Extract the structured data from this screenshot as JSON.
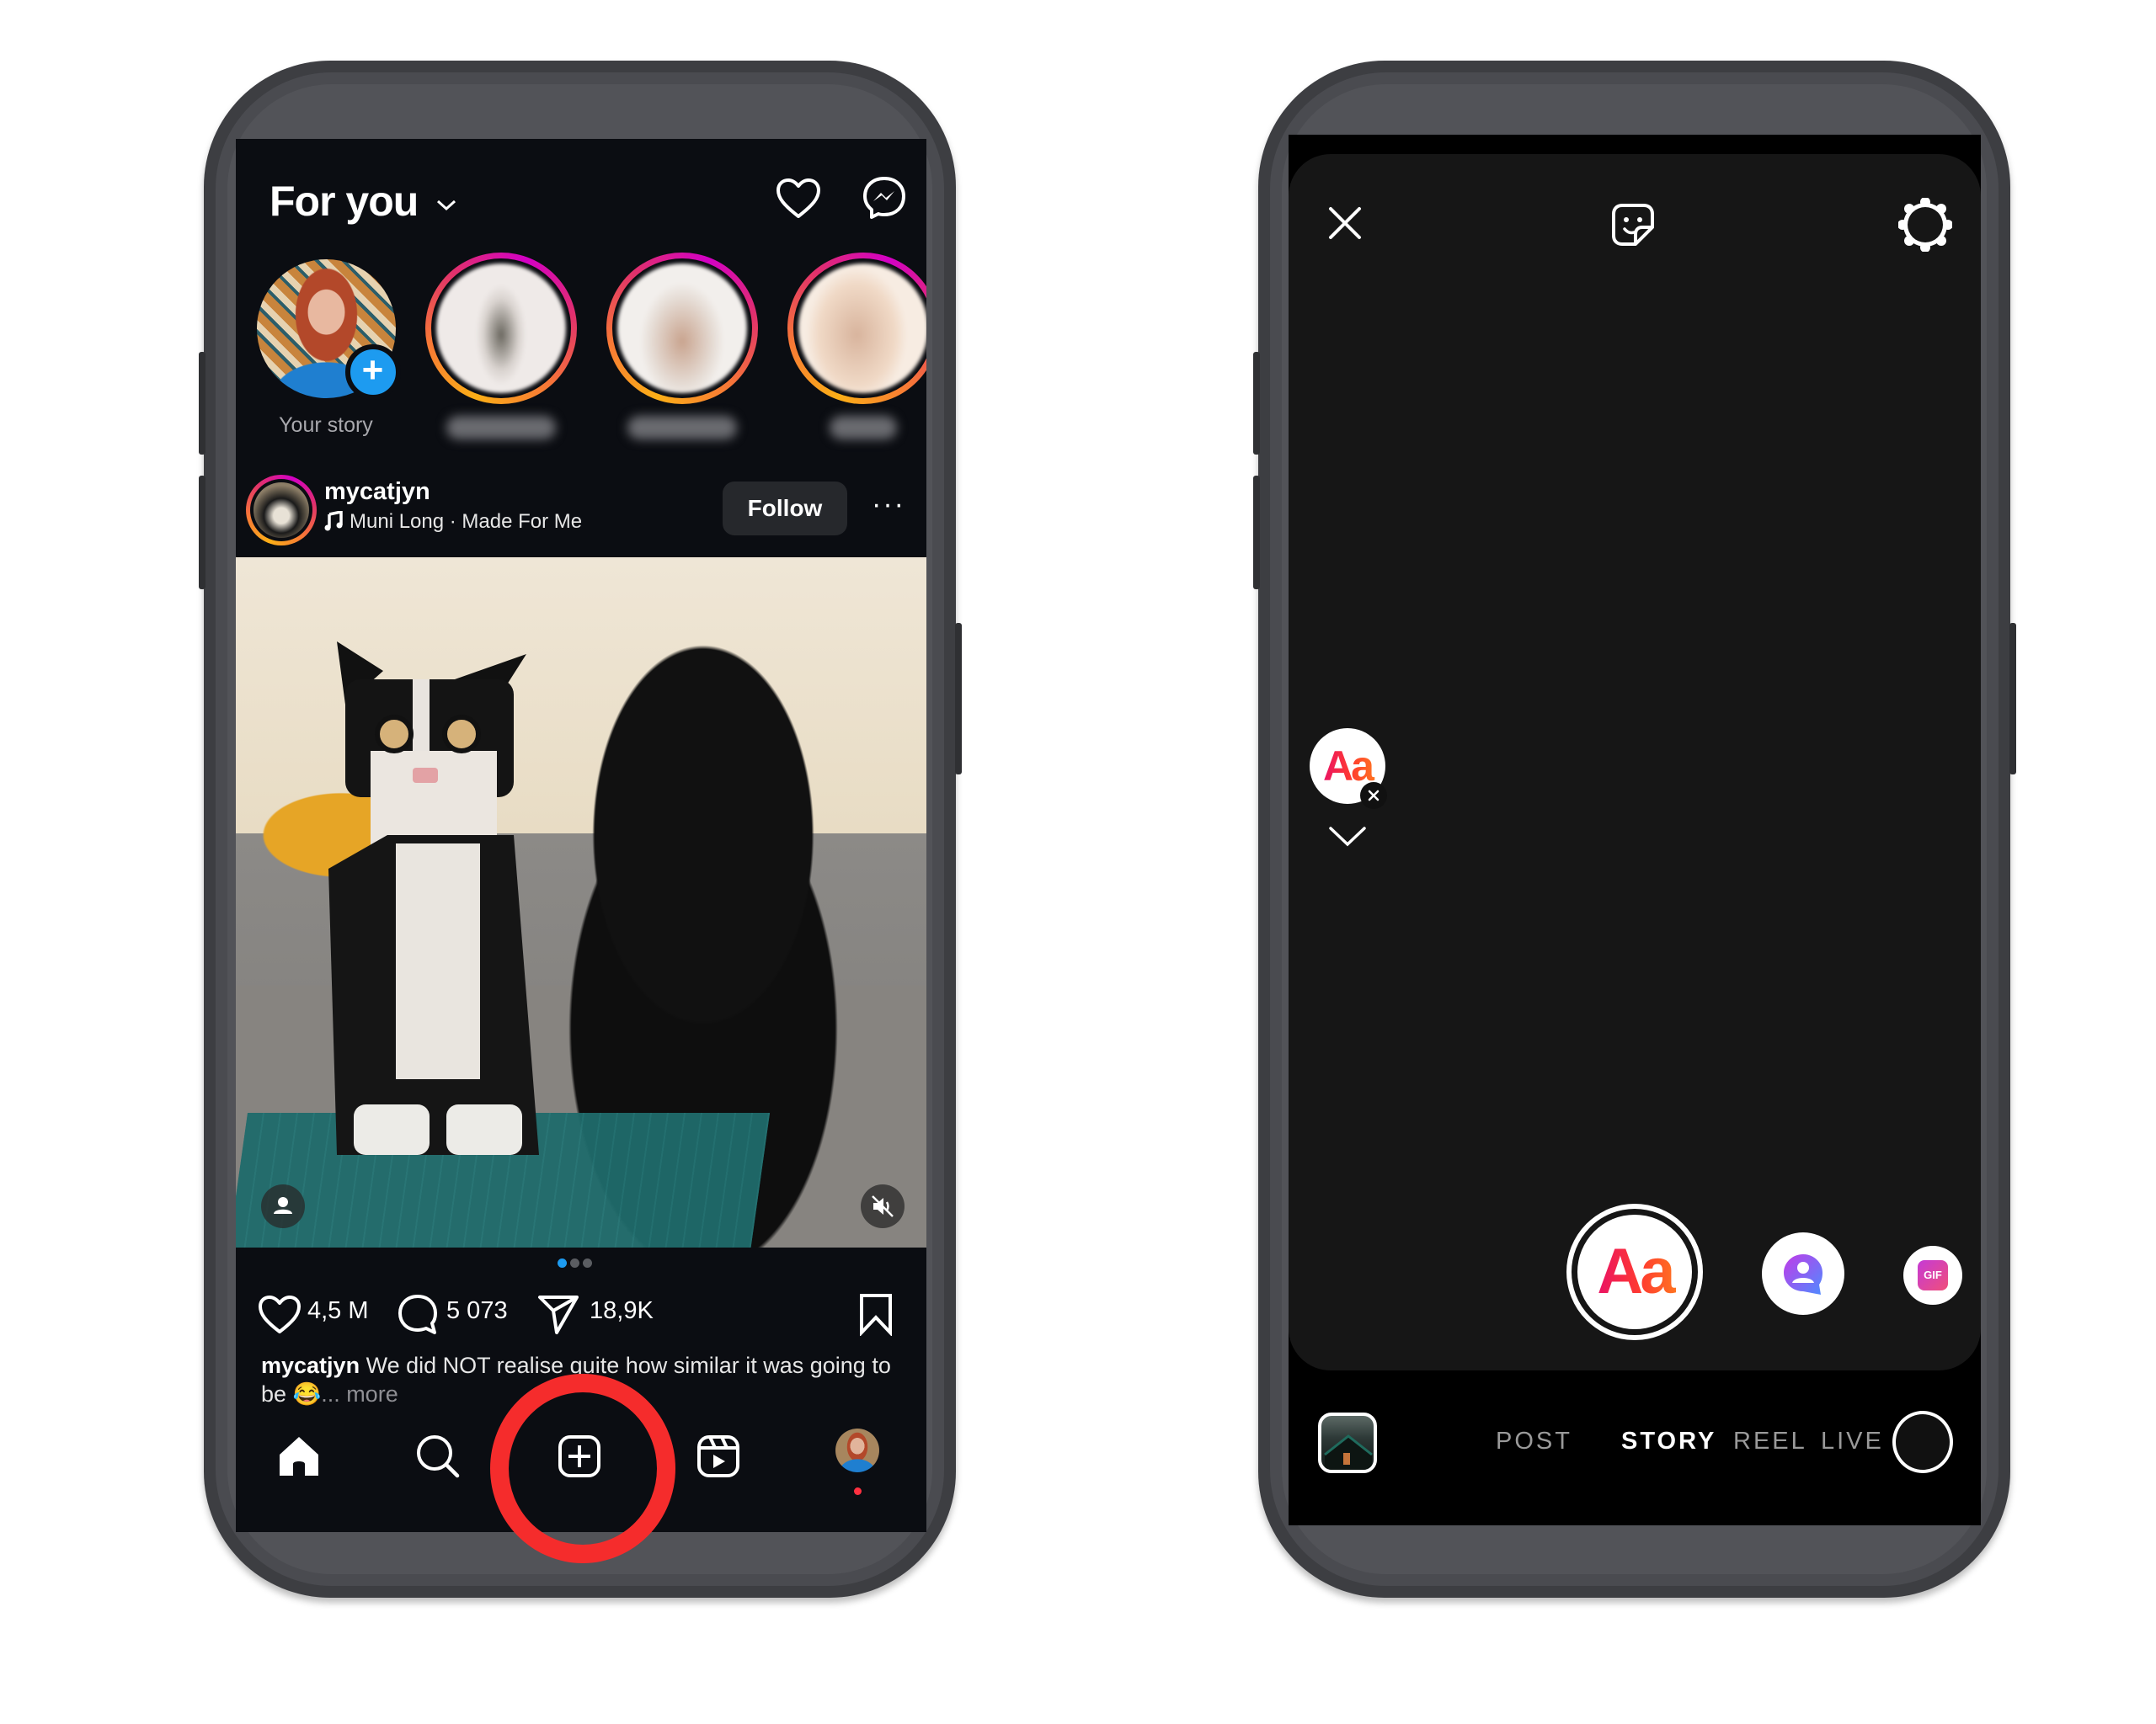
{
  "left_phone": {
    "header": {
      "title": "For you",
      "title_dropdown_icon": "chevron-down-icon",
      "icons": [
        "heart-icon",
        "messenger-icon"
      ]
    },
    "stories": {
      "own": {
        "label": "Your story",
        "badge": "+"
      },
      "others": [
        {
          "label": "",
          "blurred": true
        },
        {
          "label": "",
          "blurred": true
        },
        {
          "label": "",
          "blurred": true
        }
      ]
    },
    "post": {
      "username": "mycatjyn",
      "music_icon": "music-note-icon",
      "audio": "Muni Long · Made For Me",
      "follow_label": "Follow",
      "more_label": "···",
      "carousel": {
        "total": 3,
        "active": 1
      },
      "likes": "4,5 M",
      "comments": "5 073",
      "shares": "18,9K",
      "caption_user": "mycatjyn",
      "caption_text": "We did NOT realise quite how similar it was going to be",
      "caption_emoji": "😂",
      "caption_more": "... more"
    },
    "tabbar": {
      "items": [
        "home",
        "search",
        "create",
        "reels",
        "profile"
      ],
      "highlighted": "create"
    }
  },
  "right_phone": {
    "top_icons": [
      "close-icon",
      "sticker-icon",
      "settings-icon"
    ],
    "text_tool": {
      "label": "Aa"
    },
    "create_tools": [
      {
        "name": "text",
        "label": "Aa",
        "selected": true
      },
      {
        "name": "mention",
        "label": ""
      },
      {
        "name": "gif",
        "label": "GIF"
      }
    ],
    "modes": [
      {
        "label": "POST",
        "active": false
      },
      {
        "label": "STORY",
        "active": true
      },
      {
        "label": "REEL",
        "active": false
      },
      {
        "label": "LIVE",
        "active": false
      }
    ]
  },
  "colors": {
    "highlight": "#f52c2c",
    "accent_blue": "#1d9bf0",
    "feed_bg": "#0b0d12",
    "story_bg": "#161616"
  }
}
